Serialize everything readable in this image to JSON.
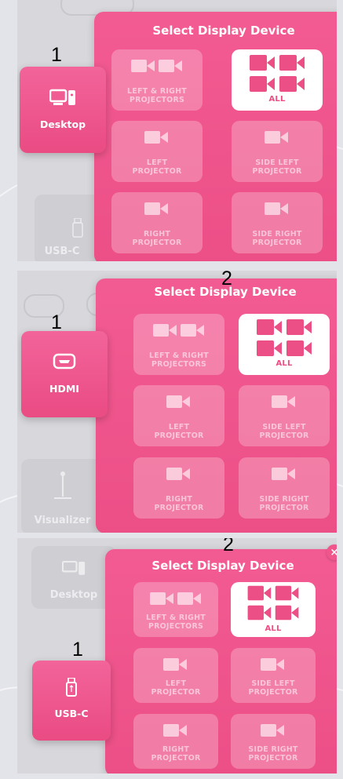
{
  "popup": {
    "title": "Select Display Device",
    "options": [
      {
        "line1": "LEFT & RIGHT",
        "line2": "PROJECTORS"
      },
      {
        "line1": "ALL",
        "line2": ""
      },
      {
        "line1": "LEFT",
        "line2": "PROJECTOR"
      },
      {
        "line1": "SIDE LEFT",
        "line2": "PROJECTOR"
      },
      {
        "line1": "RIGHT",
        "line2": "PROJECTOR"
      },
      {
        "line1": "SIDE RIGHT",
        "line2": "PROJECTOR"
      }
    ],
    "selected": "ALL"
  },
  "panels": [
    {
      "device": "Desktop",
      "device_icon": "desktop-icon",
      "marker_device": "1",
      "background": [
        "USB-C"
      ]
    },
    {
      "device": "HDMI",
      "device_icon": "hdmi-icon",
      "marker_device": "1",
      "marker_popup": "2",
      "background": [
        "Visualizer"
      ]
    },
    {
      "device": "USB-C",
      "device_icon": "usb-icon",
      "marker_device": "1",
      "marker_popup": "2",
      "background": [
        "Desktop"
      ],
      "close": "×"
    }
  ],
  "colors": {
    "accent": "#ec4f86",
    "accent_light": "#f25b92",
    "white": "#ffffff"
  }
}
